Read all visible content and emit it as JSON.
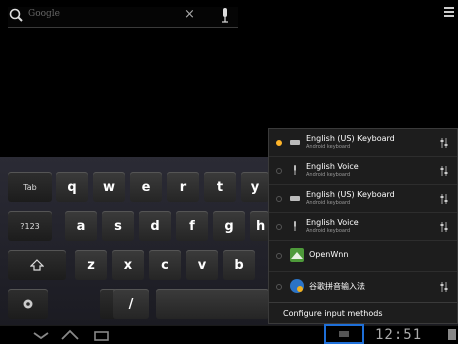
{
  "search": {
    "placeholder": "Google",
    "clear_glyph": "×"
  },
  "keyboard": {
    "rows": [
      [
        "Tab",
        "q",
        "w",
        "e",
        "r",
        "t",
        "y"
      ],
      [
        "?123",
        "a",
        "s",
        "d",
        "f",
        "g",
        "h"
      ],
      [
        "shift",
        "z",
        "x",
        "c",
        "v",
        "b"
      ],
      [
        "settings",
        ":-)",
        "/",
        "space"
      ]
    ]
  },
  "input_methods": {
    "items": [
      {
        "name": "English (US) Keyboard",
        "subtitle": "Android keyboard",
        "icon": "keyboard-icon",
        "selected": true
      },
      {
        "name": "English Voice",
        "subtitle": "Android keyboard",
        "icon": "microphone-icon",
        "selected": false
      },
      {
        "name": "English (US) Keyboard",
        "subtitle": "Android keyboard",
        "icon": "keyboard-icon",
        "selected": false
      },
      {
        "name": "English Voice",
        "subtitle": "Android keyboard",
        "icon": "microphone-icon",
        "selected": false
      },
      {
        "name": "OpenWnn",
        "subtitle": "",
        "icon": "openwnn-app-icon",
        "selected": false
      },
      {
        "name": "谷歌拼音输入法",
        "subtitle": "",
        "icon": "google-pinyin-app-icon",
        "selected": false
      }
    ],
    "configure_label": "Configure input methods"
  },
  "status_bar": {
    "clock": "12:51"
  },
  "colors": {
    "accent_highlight": "#1e6fd8",
    "radio_selected": "#ffb52a"
  }
}
